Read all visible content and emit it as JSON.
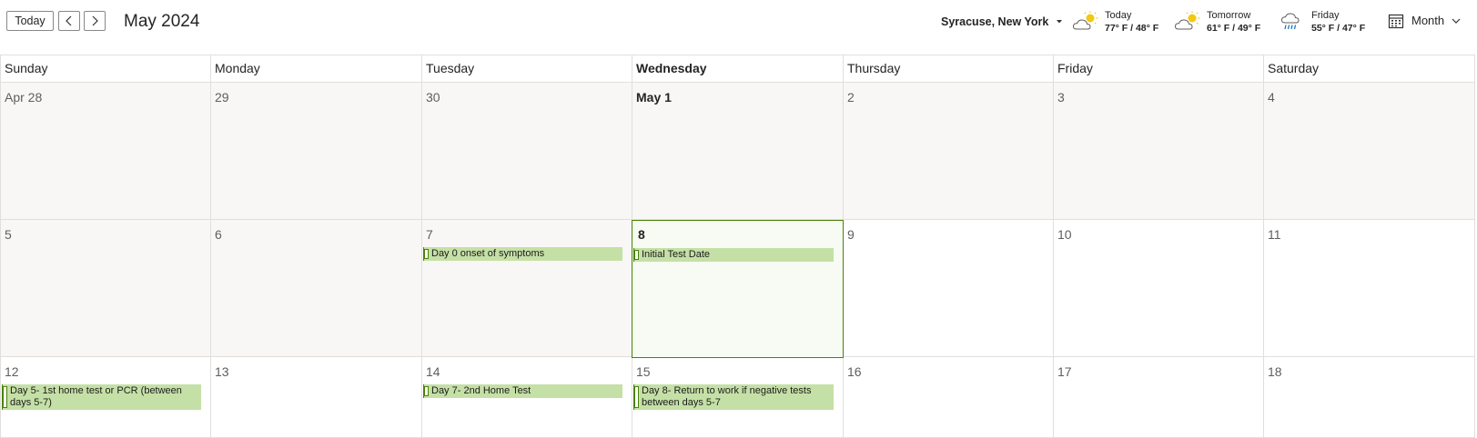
{
  "header": {
    "today_label": "Today",
    "month_title": "May 2024",
    "location": "Syracuse, New York",
    "weather": [
      {
        "day": "Today",
        "temp": "77° F / 48° F",
        "icon": "partly-sunny-icon"
      },
      {
        "day": "Tomorrow",
        "temp": "61° F / 49° F",
        "icon": "partly-sunny-icon"
      },
      {
        "day": "Friday",
        "temp": "55° F / 47° F",
        "icon": "rain-icon"
      }
    ],
    "view_label": "Month"
  },
  "colors": {
    "event_fill": "#c5e0a6",
    "event_border": "#498205",
    "other_month_bg": "#f8f7f6",
    "today_bg": "#f8fbf3"
  },
  "days_of_week": [
    "Sunday",
    "Monday",
    "Tuesday",
    "Wednesday",
    "Thursday",
    "Friday",
    "Saturday"
  ],
  "weeks": [
    [
      {
        "label": "Apr 28",
        "other_month": true
      },
      {
        "label": "29",
        "other_month": true
      },
      {
        "label": "30",
        "other_month": true
      },
      {
        "label": "May 1",
        "bold": true,
        "other_month": true
      },
      {
        "label": "2",
        "other_month": true
      },
      {
        "label": "3",
        "other_month": true
      },
      {
        "label": "4",
        "other_month": true
      }
    ],
    [
      {
        "label": "5",
        "other_month": true
      },
      {
        "label": "6",
        "other_month": true
      },
      {
        "label": "7",
        "other_month": true,
        "events": [
          "Day 0 onset of symptoms"
        ]
      },
      {
        "label": "8",
        "today": true,
        "events": [
          "Initial Test Date"
        ]
      },
      {
        "label": "9"
      },
      {
        "label": "10"
      },
      {
        "label": "11"
      }
    ],
    [
      {
        "label": "12",
        "events": [
          "Day 5- 1st home test or PCR (between days 5-7)"
        ]
      },
      {
        "label": "13"
      },
      {
        "label": "14",
        "events": [
          "Day 7- 2nd Home Test"
        ]
      },
      {
        "label": "15",
        "events": [
          "Day 8- Return to work if negative tests between days 5-7"
        ]
      },
      {
        "label": "16"
      },
      {
        "label": "17"
      },
      {
        "label": "18"
      }
    ]
  ]
}
